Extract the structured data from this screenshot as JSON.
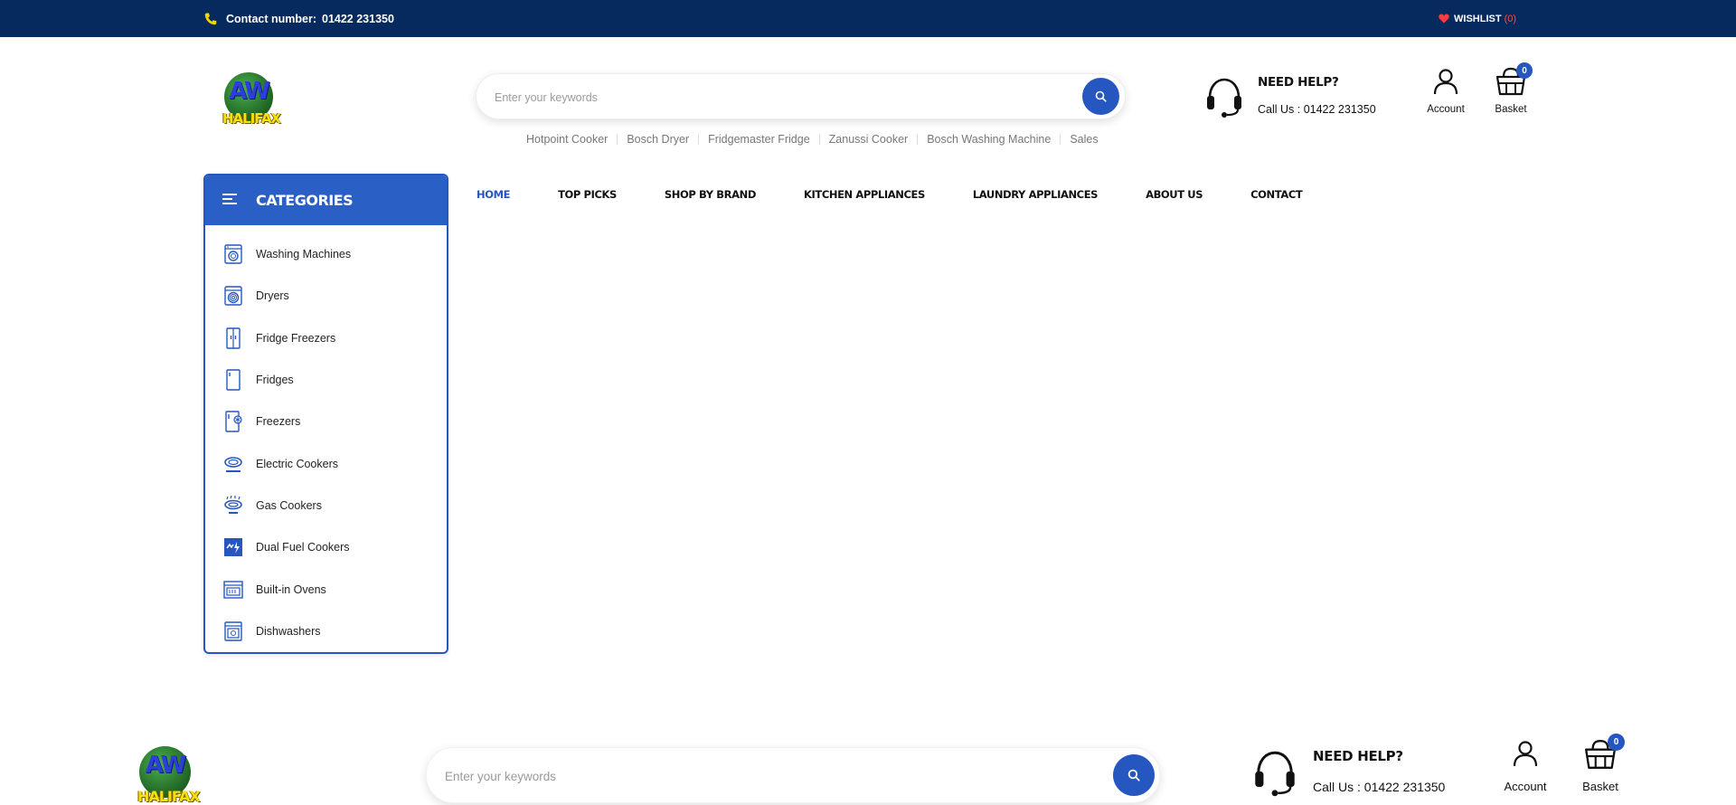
{
  "topbar": {
    "contact_label": "Contact number:",
    "contact_number": "01422 231350",
    "wishlist_label": "WISHLIST",
    "wishlist_count": "(0)"
  },
  "logo": {
    "line1": "AW",
    "line2": "HALIFAX"
  },
  "search": {
    "placeholder": "Enter your keywords"
  },
  "popular_searches": [
    "Hotpoint Cooker",
    "Bosch Dryer",
    "Fridgemaster Fridge",
    "Zanussi Cooker",
    "Bosch Washing Machine",
    "Sales"
  ],
  "help": {
    "title": "NEED HELP?",
    "call": "Call Us : 01422 231350"
  },
  "account": {
    "label": "Account"
  },
  "basket": {
    "label": "Basket",
    "count": "0"
  },
  "categories": {
    "title": "CATEGORIES",
    "items": [
      {
        "label": "Washing Machines",
        "icon": "washing-machine-icon"
      },
      {
        "label": "Dryers",
        "icon": "dryer-icon"
      },
      {
        "label": "Fridge Freezers",
        "icon": "fridge-freezer-icon"
      },
      {
        "label": "Fridges",
        "icon": "fridge-icon"
      },
      {
        "label": "Freezers",
        "icon": "freezer-icon"
      },
      {
        "label": "Electric Cookers",
        "icon": "electric-cooker-icon"
      },
      {
        "label": "Gas Cookers",
        "icon": "gas-cooker-icon"
      },
      {
        "label": "Dual Fuel Cookers",
        "icon": "dual-fuel-cooker-icon"
      },
      {
        "label": "Built-in Ovens",
        "icon": "built-in-oven-icon"
      },
      {
        "label": "Dishwashers",
        "icon": "dishwasher-icon"
      }
    ]
  },
  "nav": {
    "items": [
      "HOME",
      "TOP PICKS",
      "SHOP BY BRAND",
      "KITCHEN APPLIANCES",
      "LAUNDRY APPLIANCES",
      "ABOUT US",
      "CONTACT"
    ],
    "active": "HOME"
  },
  "colors": {
    "topbar": "#062a5e",
    "accent": "#2657c1",
    "wishlist_count": "#ff4a4a"
  }
}
